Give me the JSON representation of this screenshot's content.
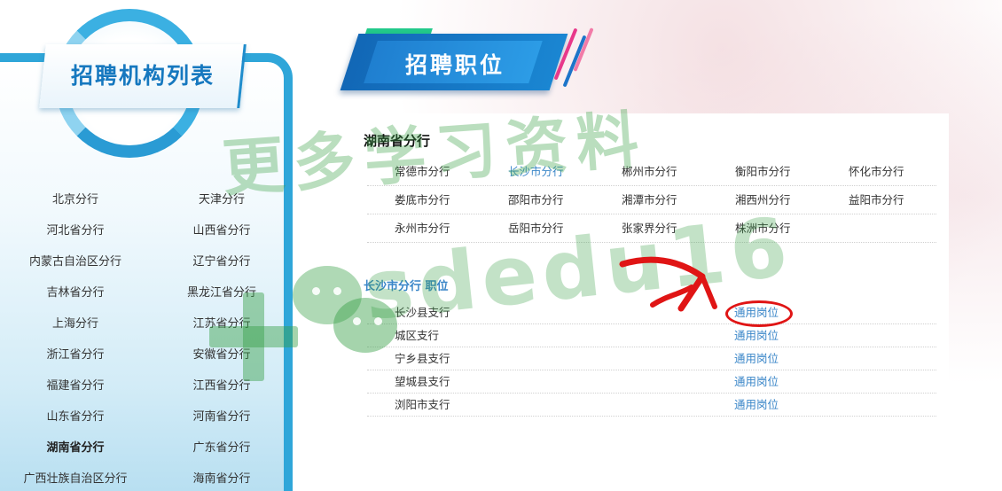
{
  "sidebar": {
    "title": "招聘机构列表",
    "branches": [
      {
        "label": "北京分行"
      },
      {
        "label": "天津分行"
      },
      {
        "label": "河北省分行"
      },
      {
        "label": "山西省分行"
      },
      {
        "label": "内蒙古自治区分行"
      },
      {
        "label": "辽宁省分行"
      },
      {
        "label": "吉林省分行"
      },
      {
        "label": "黑龙江省分行"
      },
      {
        "label": "上海分行"
      },
      {
        "label": "江苏省分行"
      },
      {
        "label": "浙江省分行"
      },
      {
        "label": "安徽省分行"
      },
      {
        "label": "福建省分行"
      },
      {
        "label": "江西省分行"
      },
      {
        "label": "山东省分行"
      },
      {
        "label": "河南省分行"
      },
      {
        "label": "湖南省分行",
        "active": true
      },
      {
        "label": "广东省分行"
      },
      {
        "label": "广西壮族自治区分行"
      },
      {
        "label": "海南省分行"
      }
    ]
  },
  "header": {
    "title": "招聘职位"
  },
  "section": {
    "title": "湖南省分行",
    "cities": [
      [
        "常德市分行",
        "长沙市分行",
        "郴州市分行",
        "衡阳市分行",
        "怀化市分行"
      ],
      [
        "娄底市分行",
        "邵阳市分行",
        "湘潭市分行",
        "湘西州分行",
        "益阳市分行"
      ],
      [
        "永州市分行",
        "岳阳市分行",
        "张家界分行",
        "株洲市分行",
        ""
      ]
    ],
    "selected_city": "长沙市分行"
  },
  "positions": {
    "heading": "长沙市分行 职位",
    "rows": [
      {
        "branch": "长沙县支行",
        "post": "通用岗位"
      },
      {
        "branch": "城区支行",
        "post": "通用岗位"
      },
      {
        "branch": "宁乡县支行",
        "post": "通用岗位"
      },
      {
        "branch": "望城县支行",
        "post": "通用岗位"
      },
      {
        "branch": "浏阳市支行",
        "post": "通用岗位"
      }
    ]
  },
  "watermark": {
    "text": "更多学习资料",
    "handle": "sdedu16"
  },
  "colors": {
    "accent_blue": "#1678bf",
    "link_blue": "#3a86c8",
    "banner_green": "#22c98a",
    "annotation_red": "#e01515",
    "watermark_green": "#38a046"
  }
}
